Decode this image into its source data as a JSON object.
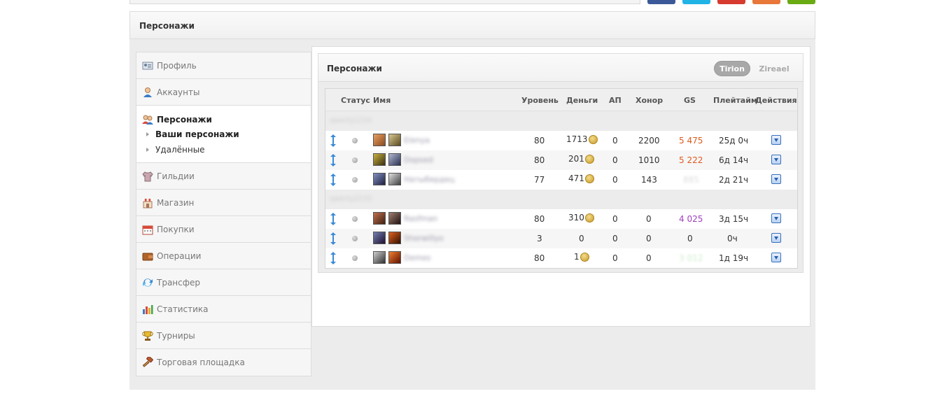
{
  "colors": {
    "social": [
      "#3b5998",
      "#1fb3e6",
      "#d73b30",
      "#e8773a",
      "#6aab14"
    ],
    "accent_arrow": "#3a8ad6"
  },
  "page": {
    "title": "Персонажи"
  },
  "sidebar": {
    "items_top": [
      {
        "label": "Профиль",
        "icon": "profile-card-icon"
      },
      {
        "label": "Аккаунты",
        "icon": "user-icon"
      }
    ],
    "active": {
      "label": "Персонажи",
      "icon": "users-icon",
      "subitems": [
        {
          "label": "Ваши персонажи"
        },
        {
          "label": "Удалённые"
        }
      ]
    },
    "items_bottom": [
      {
        "label": "Гильдии",
        "icon": "shirt-icon"
      },
      {
        "label": "Магазин",
        "icon": "shop-icon"
      },
      {
        "label": "Покупки",
        "icon": "calendar-icon"
      },
      {
        "label": "Операции",
        "icon": "wallet-icon"
      },
      {
        "label": "Трансфер",
        "icon": "transfer-icon"
      },
      {
        "label": "Статистика",
        "icon": "chart-icon"
      },
      {
        "label": "Турниры",
        "icon": "trophy-icon"
      },
      {
        "label": "Торговая площадка",
        "icon": "hammer-icon"
      }
    ]
  },
  "characters_panel": {
    "title": "Персонажи",
    "realms": [
      "Tirion",
      "Zireael"
    ],
    "active_realm": "Tirion",
    "columns": {
      "status": "Статус",
      "name": "Имя",
      "level": "Уровень",
      "money": "Деньги",
      "ap": "АП",
      "honor": "Хонор",
      "gs": "GS",
      "playtime": "Плейтайм",
      "actions": "Действия"
    },
    "groups": [
      {
        "account": "qwerty1234",
        "rows": [
          {
            "name": "Elenya",
            "level": "80",
            "money": "1713",
            "ap": "0",
            "honor": "2200",
            "gs": "5 475",
            "gs_class": "gs-orange",
            "playtime": "25д 0ч",
            "coin": true
          },
          {
            "name": "Dopsed",
            "level": "80",
            "money": "201",
            "ap": "0",
            "honor": "1010",
            "gs": "5 222",
            "gs_class": "gs-orange",
            "playtime": "6д 14ч",
            "coin": true
          },
          {
            "name": "Натыбердец",
            "level": "77",
            "money": "471",
            "ap": "0",
            "honor": "143",
            "gs": "885",
            "gs_class": "gs-faint",
            "playtime": "2д 21ч",
            "coin": true
          }
        ]
      },
      {
        "account": "qwerty2233",
        "rows": [
          {
            "name": "Rasfman",
            "level": "80",
            "money": "310",
            "ap": "0",
            "honor": "0",
            "gs": "4 025",
            "gs_class": "gs-purple",
            "playtime": "3д 15ч",
            "coin": true
          },
          {
            "name": "Sherwillyo",
            "level": "3",
            "money": "0",
            "ap": "0",
            "honor": "0",
            "gs": "0",
            "gs_class": "",
            "playtime": "0ч",
            "coin": false
          },
          {
            "name": "Demes",
            "level": "80",
            "money": "1",
            "ap": "0",
            "honor": "0",
            "gs": "3 012",
            "gs_class": "gs-green",
            "playtime": "1д 19ч",
            "coin": true
          }
        ]
      }
    ]
  }
}
